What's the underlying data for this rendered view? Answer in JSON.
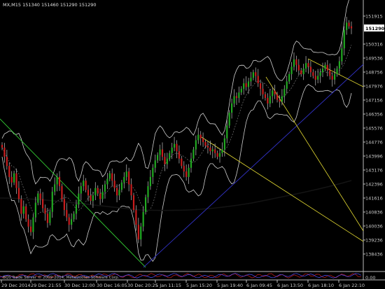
{
  "header": {
    "symbol_info": "MX,M15  151340  151460  151290  151290"
  },
  "footer": {
    "copyright": "BQS Trade Server © 2009-2014, MetaQuotes Software Corp."
  },
  "price_axis": {
    "labels": [
      "151915",
      "151290",
      "150316",
      "149536",
      "148756",
      "147976",
      "147156",
      "146356",
      "145576",
      "144776",
      "143996",
      "143176",
      "142396",
      "141616",
      "140836",
      "140036",
      "139236",
      "138436"
    ],
    "current_price": "151290"
  },
  "lower_panel": {
    "scale_label": "0.00"
  },
  "colors": {
    "background": "#000000",
    "candle_bull": "#22aa22",
    "candle_bear": "#c81e1e",
    "wick": "#aaaaaa",
    "bollinger": "#cfcfcf",
    "moving_average": "#1f1f1f",
    "trend_blue": "#3232c8",
    "trend_green": "#32c832",
    "trend_yellow": "#e6dc32",
    "indicator_red": "#c81e1e",
    "indicator_blue": "#5050ff"
  },
  "chart_data": {
    "type": "candlestick",
    "time_labels": [
      "29 Dec 2014",
      "29 Dec 21:55",
      "30 Dec 12:00",
      "30 Dec 16:05",
      "30 Dec 20:25",
      "5 Jan 11:15",
      "5 Jan 15:20",
      "5 Jan 19:40",
      "6 Jan 09:45",
      "6 Jan 13:50",
      "6 Jan 18:10",
      "6 Jan 22:10"
    ],
    "ylim": [
      138436,
      152300
    ],
    "close_path": [
      144800,
      144300,
      143800,
      143200,
      142900,
      143400,
      142600,
      142000,
      141200,
      141600,
      140900,
      140500,
      140200,
      141000,
      141800,
      142300,
      142000,
      141500,
      141200,
      140700,
      141300,
      142400,
      142800,
      143200,
      142700,
      142000,
      141400,
      141000,
      140600,
      140900,
      141200,
      141700,
      142300,
      142700,
      143000,
      142500,
      142200,
      141900,
      142200,
      142600,
      142300,
      142000,
      142400,
      142800,
      143100,
      143400,
      143000,
      142600,
      142200,
      142500,
      142900,
      143200,
      143500,
      142800,
      142200,
      141400,
      140600,
      139800,
      140500,
      141300,
      142100,
      142700,
      143200,
      143700,
      144100,
      144400,
      144700,
      144300,
      143900,
      144200,
      144500,
      144800,
      145000,
      144600,
      144200,
      143800,
      143500,
      143200,
      143700,
      144200,
      144700,
      145200,
      145500,
      145300,
      145100,
      144900,
      144800,
      144600,
      144700,
      144500,
      144300,
      144500,
      144700,
      145300,
      146000,
      146700,
      147200,
      147600,
      147500,
      147800,
      148000,
      148300,
      148100,
      148400,
      148600,
      148900,
      148700,
      148300,
      148000,
      147700,
      147500,
      147200,
      147600,
      147900,
      147700,
      147400,
      147300,
      147600,
      148000,
      148400,
      148800,
      149200,
      149600,
      149300,
      149000,
      148800,
      149100,
      149400,
      149200,
      148900,
      148700,
      148500,
      148700,
      148900,
      149100,
      149300,
      149000,
      148700,
      148500,
      148800,
      149100,
      149500,
      150200,
      151200,
      151600,
      151400,
      151290
    ]
  }
}
